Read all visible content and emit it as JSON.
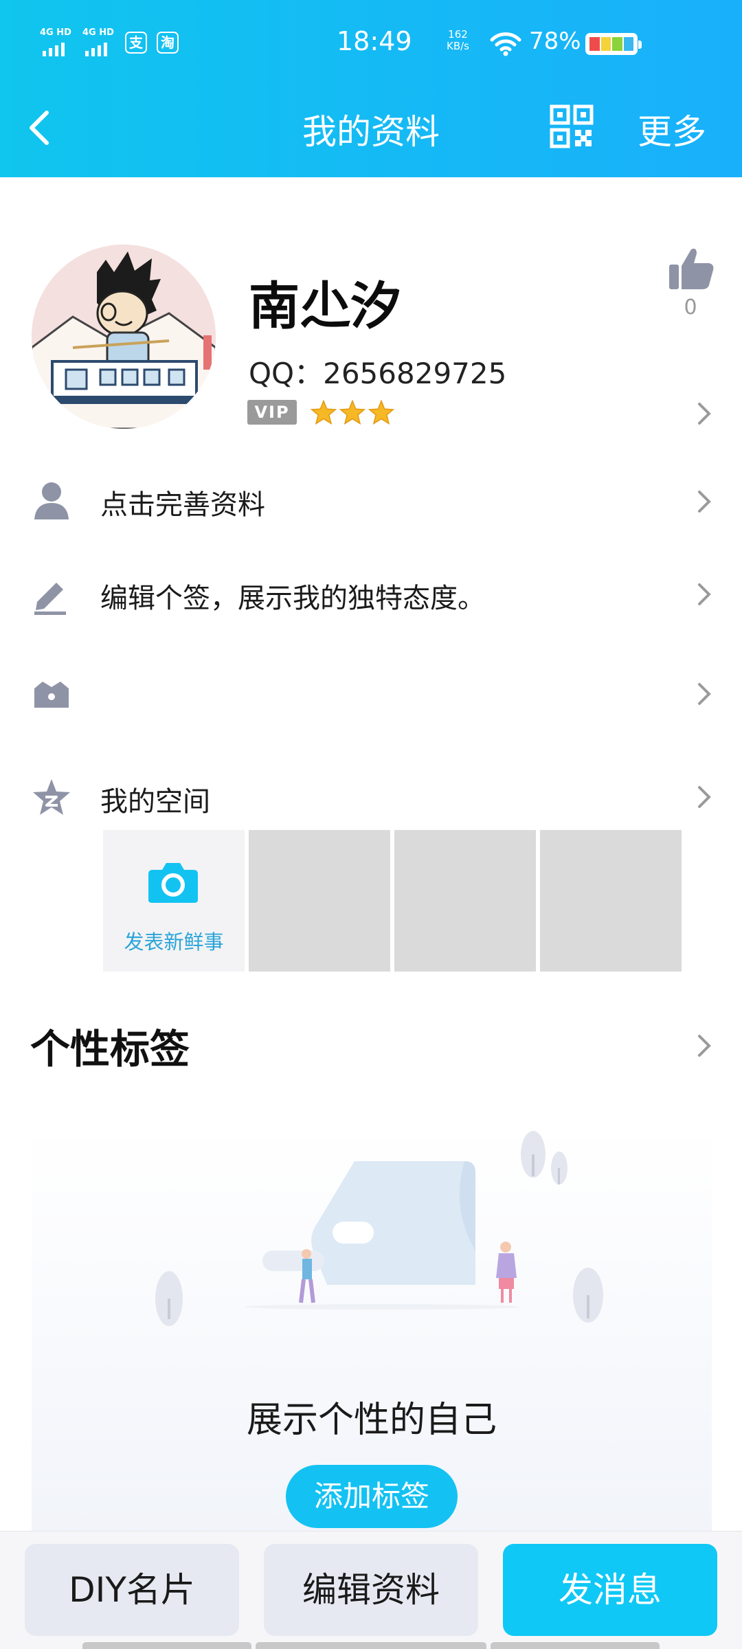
{
  "status_bar": {
    "network_1": "4G HD",
    "network_2": "4G HD",
    "app_icon_1": "支",
    "app_icon_2": "淘",
    "time": "18:49",
    "speed_value": "162",
    "speed_unit": "KB/s",
    "battery_percent": "78%",
    "battery_level": 0.78
  },
  "nav": {
    "title": "我的资料",
    "more_label": "更多",
    "back_icon": "chevron-left-icon",
    "qr_icon": "qr-code-icon"
  },
  "profile": {
    "name": "南尐汐",
    "qq": "QQ：2656829725",
    "vip_label": "VIP",
    "star_count": 3,
    "like_count": "0"
  },
  "rows": {
    "complete_profile": "点击完善资料",
    "signature": "编辑个签，展示我的独特态度。",
    "badge": "",
    "my_zone": "我的空间"
  },
  "zone": {
    "post_label": "发表新鲜事"
  },
  "tags": {
    "section_title": "个性标签",
    "empty_message": "展示个性的自己",
    "add_button": "添加标签"
  },
  "bottom_bar": {
    "diy_card": "DIY名片",
    "edit_profile": "编辑资料",
    "send_message": "发消息"
  },
  "colors": {
    "header_start": "#10c5ee",
    "header_end": "#19b0fb",
    "accent": "#0fc8f5",
    "icon_gray": "#8f93a6"
  }
}
